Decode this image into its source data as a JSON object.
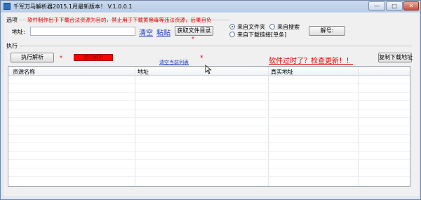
{
  "window": {
    "title": "千军万马解析器2015.1月最新版本！ V.1.0.0.1",
    "controls": {
      "minimize": "—",
      "maximize": "□",
      "close": "✕"
    }
  },
  "options": {
    "section_label": "选项",
    "notice": "软件制作出于下载合法资源为目的，禁止用于下载黄赌毒等违法资源，后果自负",
    "address_label": "地址:",
    "address_value": "",
    "clear_link": "清空",
    "paste_link": "粘贴",
    "get_dir_button": "获取文件目录",
    "asterisk_small": "*",
    "radio_folder": "来自文件夹",
    "radio_seed": "来自搜索",
    "radio_link": "来自下载链接[单条]",
    "unlock_button": "解号:"
  },
  "execute": {
    "section_label": "执行",
    "run_button": "执行解析",
    "asterisk": "*",
    "status_box": "暂时解析",
    "clear_list_link": "清空当前列表",
    "asterisk2": "*",
    "update_notice": "软件过时了？检查更新！！",
    "copy_button": "复制下载地址"
  },
  "table": {
    "columns": [
      "资源名称",
      "地址",
      "真实地址"
    ]
  },
  "colors": {
    "title_bar": "#b9cde6",
    "notice_red": "#e00000",
    "status_red": "#ff0000",
    "link_blue": "#1a3cc0"
  }
}
